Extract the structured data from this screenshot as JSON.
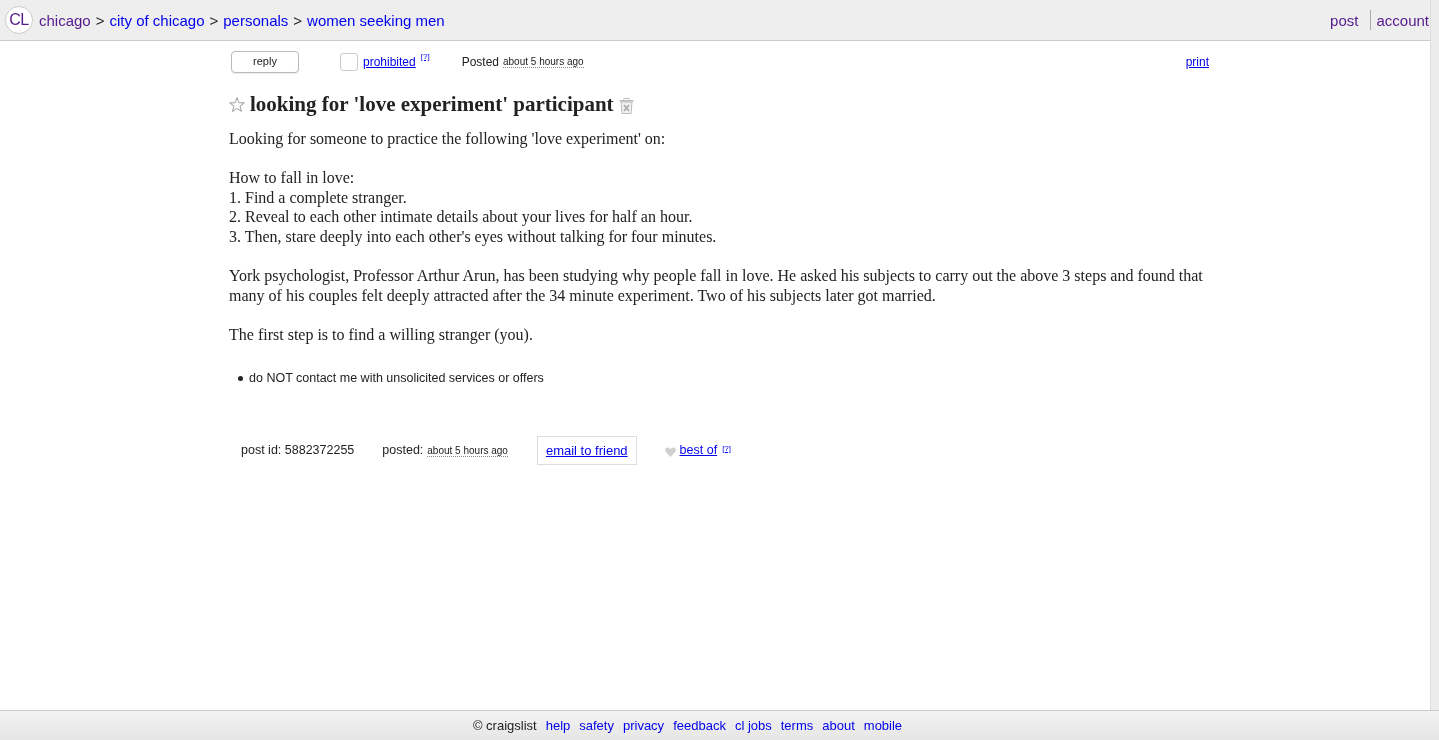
{
  "header": {
    "logo": "CL",
    "breadcrumb_separator": ">",
    "breadcrumbs": [
      {
        "label": "chicago",
        "visited": true
      },
      {
        "label": "city of chicago",
        "visited": false
      },
      {
        "label": "personals",
        "visited": false
      },
      {
        "label": "women seeking men",
        "visited": false
      }
    ],
    "links": [
      {
        "label": "post",
        "visited": true
      },
      {
        "label": "account",
        "visited": true
      }
    ]
  },
  "toolbar": {
    "reply_button": "reply",
    "flag": {
      "label": "prohibited",
      "checked": false,
      "help": "[?]"
    },
    "posted": {
      "label": "Posted",
      "time": "about 5 hours ago"
    },
    "print": "print"
  },
  "post": {
    "title": "looking for 'love experiment' participant",
    "favorited": false,
    "paragraphs": [
      [
        "Looking for someone to practice the following 'love experiment' on:"
      ],
      [
        "How to fall in love:",
        "1. Find a complete stranger.",
        "2. Reveal to each other intimate details about your lives for half an hour.",
        "3. Then, stare deeply into each other's eyes without talking for four minutes."
      ],
      [
        "York psychologist, Professor Arthur Arun, has been studying why people fall in love. He asked his subjects to carry out the above 3 steps and found that many of his couples felt deeply attracted after the 34 minute experiment. Two of his subjects later got married."
      ],
      [
        "The first step is to find a willing stranger (you)."
      ]
    ],
    "notices": [
      "do NOT contact me with unsolicited services or offers"
    ]
  },
  "post_info": {
    "post_id": "post id: 5882372255",
    "posted_label": "posted:",
    "posted_time": "about 5 hours ago",
    "email_button": "email to friend",
    "best_of": {
      "label": "best of",
      "help": "[?]"
    }
  },
  "footer": {
    "copyright": "© craigslist",
    "links": [
      "help",
      "safety",
      "privacy",
      "feedback",
      "cl jobs",
      "terms",
      "about",
      "mobile"
    ]
  }
}
